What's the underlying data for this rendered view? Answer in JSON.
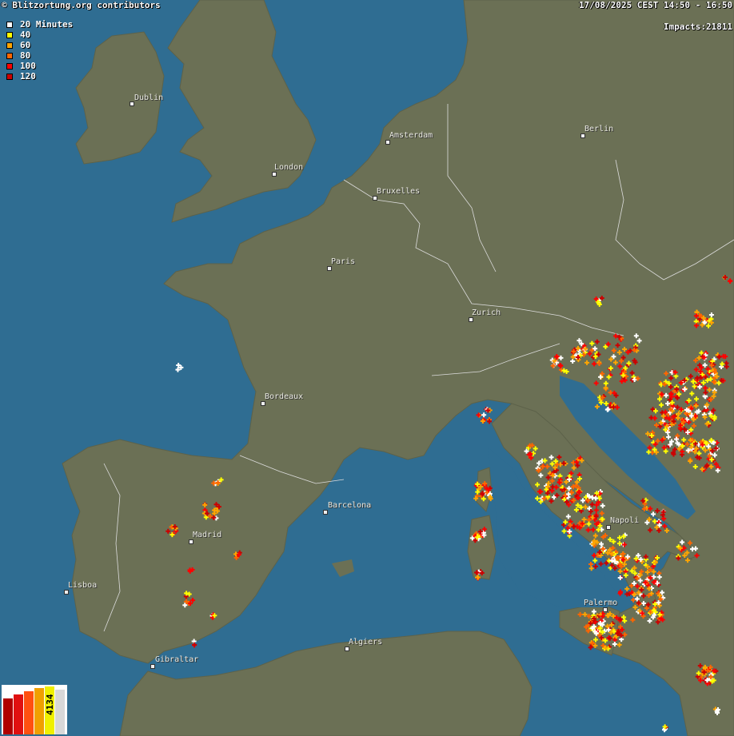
{
  "header": {
    "attribution": "© Blitzortung.org contributors",
    "time_range": "17/08/2025 CEST 14:50 - 16:50",
    "impacts": "Impacts:21811"
  },
  "legend": [
    {
      "label": "20 Minutes",
      "color": "#ffffff"
    },
    {
      "label": "40",
      "color": "#ffff00"
    },
    {
      "label": "60",
      "color": "#ffa500"
    },
    {
      "label": "80",
      "color": "#ff6600"
    },
    {
      "label": "100",
      "color": "#ff0000"
    },
    {
      "label": "120",
      "color": "#cc0000"
    }
  ],
  "cities": [
    "Dublin",
    "London",
    "Amsterdam",
    "Berlin",
    "Bruxelles",
    "Paris",
    "Zurich",
    "Bordeaux",
    "Madrid",
    "Barcelona",
    "Lisboa",
    "Napoli",
    "Palermo",
    "Gibraltar",
    "Algiers"
  ],
  "counter": {
    "value": "4134"
  },
  "colors": {
    "sea": "#2f6d92",
    "land": "#6b7055",
    "border": "#dcdcdc"
  }
}
